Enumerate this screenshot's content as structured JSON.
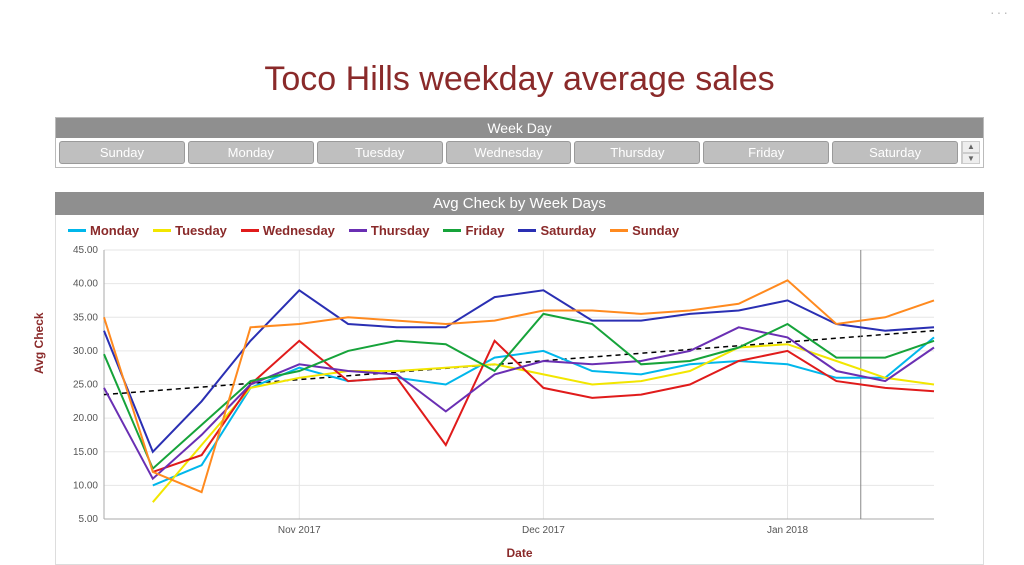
{
  "title": "Toco Hills weekday average sales",
  "filter": {
    "title": "Week Day",
    "options": [
      "Sunday",
      "Monday",
      "Tuesday",
      "Wednesday",
      "Thursday",
      "Friday",
      "Saturday"
    ]
  },
  "chart_data": {
    "type": "line",
    "title": "Avg Check by Week Days",
    "xlabel": "Date",
    "ylabel": "Avg Check",
    "ylim": [
      5,
      45
    ],
    "yticks": [
      5,
      10,
      15,
      20,
      25,
      30,
      35,
      40,
      45
    ],
    "xtick_labels": {
      "4": "Nov 2017",
      "9": "Dec 2017",
      "14": "Jan 2018"
    },
    "x_index": [
      0,
      1,
      2,
      3,
      4,
      5,
      6,
      7,
      8,
      9,
      10,
      11,
      12,
      13,
      14,
      15,
      16,
      17
    ],
    "cursor_at": 15.5,
    "trendline": {
      "start_y": 23.5,
      "end_y": 33.0
    },
    "series": [
      {
        "name": "Monday",
        "color": "#00b7eb",
        "values": [
          null,
          10.0,
          13.0,
          24.5,
          27.5,
          25.5,
          26.0,
          25.0,
          29.0,
          30.0,
          27.0,
          26.5,
          28.0,
          28.5,
          28.0,
          26.0,
          26.0,
          32.0
        ]
      },
      {
        "name": "Tuesday",
        "color": "#f2e600",
        "values": [
          null,
          7.5,
          16.0,
          24.5,
          26.0,
          27.0,
          27.0,
          27.5,
          28.0,
          26.5,
          25.0,
          25.5,
          27.0,
          30.5,
          31.0,
          28.5,
          26.0,
          25.0
        ]
      },
      {
        "name": "Wednesday",
        "color": "#e01b1b",
        "values": [
          null,
          12.0,
          14.5,
          25.0,
          31.5,
          25.5,
          26.0,
          16.0,
          31.5,
          24.5,
          23.0,
          23.5,
          25.0,
          28.5,
          30.0,
          25.5,
          24.5,
          24.0
        ]
      },
      {
        "name": "Thursday",
        "color": "#6a2fb3",
        "values": [
          24.5,
          11.0,
          17.5,
          25.0,
          28.0,
          27.0,
          26.5,
          21.0,
          26.5,
          28.5,
          28.0,
          28.5,
          30.0,
          33.5,
          32.0,
          27.0,
          25.5,
          30.5
        ]
      },
      {
        "name": "Friday",
        "color": "#16a33a",
        "values": [
          29.5,
          12.5,
          19.0,
          25.5,
          27.0,
          30.0,
          31.5,
          31.0,
          27.0,
          35.5,
          34.0,
          28.0,
          28.5,
          30.5,
          34.0,
          29.0,
          29.0,
          31.5
        ]
      },
      {
        "name": "Saturday",
        "color": "#2a2fb3",
        "values": [
          33.0,
          15.0,
          22.5,
          31.5,
          39.0,
          34.0,
          33.5,
          33.5,
          38.0,
          39.0,
          34.5,
          34.5,
          35.5,
          36.0,
          37.5,
          34.0,
          33.0,
          33.5
        ]
      },
      {
        "name": "Sunday",
        "color": "#ff8a1f",
        "values": [
          35.0,
          12.0,
          9.0,
          33.5,
          34.0,
          35.0,
          34.5,
          34.0,
          34.5,
          36.0,
          36.0,
          35.5,
          36.0,
          37.0,
          40.5,
          34.0,
          35.0,
          37.5
        ]
      }
    ]
  }
}
